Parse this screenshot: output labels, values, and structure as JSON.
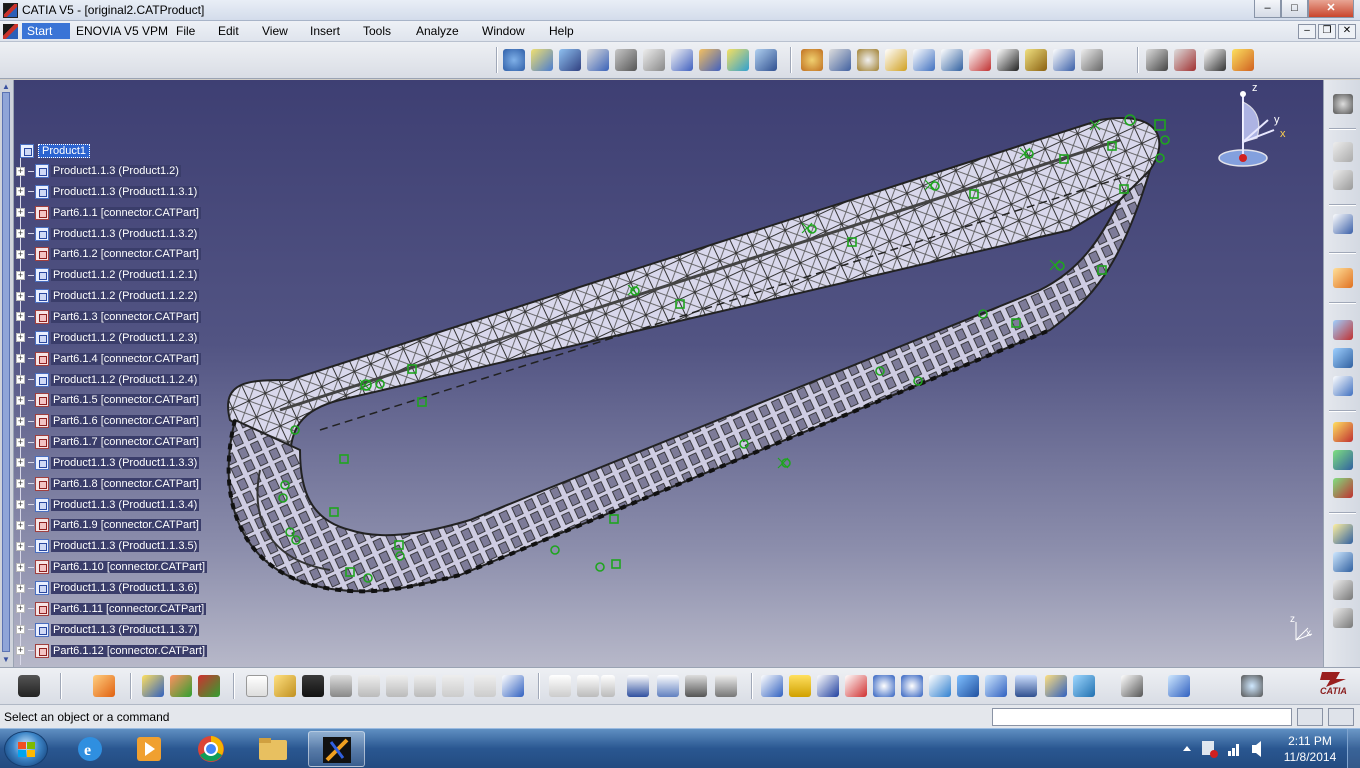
{
  "window": {
    "title": "CATIA V5 - [original2.CATProduct]",
    "buttons": {
      "minimize": "–",
      "maximize": "□",
      "close": "✕"
    }
  },
  "menu": {
    "items": [
      "Start",
      "ENOVIA V5 VPM",
      "File",
      "Edit",
      "View",
      "Insert",
      "Tools",
      "Analyze",
      "Window",
      "Help"
    ],
    "doc_buttons": {
      "minimize": "–",
      "restore": "❐",
      "close": "✕"
    }
  },
  "tree": {
    "root": "Product1",
    "nodes": [
      {
        "label": "Product1.1.3 (Product1.2)",
        "kind": "product"
      },
      {
        "label": "Product1.1.3 (Product1.1.3.1)",
        "kind": "product"
      },
      {
        "label": "Part6.1.1 [connector.CATPart]",
        "kind": "part"
      },
      {
        "label": "Product1.1.3 (Product1.1.3.2)",
        "kind": "product"
      },
      {
        "label": "Part6.1.2 [connector.CATPart]",
        "kind": "part"
      },
      {
        "label": "Product1.1.2 (Product1.1.2.1)",
        "kind": "product"
      },
      {
        "label": "Product1.1.2 (Product1.1.2.2)",
        "kind": "product"
      },
      {
        "label": "Part6.1.3 [connector.CATPart]",
        "kind": "part"
      },
      {
        "label": "Product1.1.2 (Product1.1.2.3)",
        "kind": "product"
      },
      {
        "label": "Part6.1.4 [connector.CATPart]",
        "kind": "part"
      },
      {
        "label": "Product1.1.2 (Product1.1.2.4)",
        "kind": "product"
      },
      {
        "label": "Part6.1.5 [connector.CATPart]",
        "kind": "part"
      },
      {
        "label": "Part6.1.6 [connector.CATPart]",
        "kind": "part"
      },
      {
        "label": "Part6.1.7 [connector.CATPart]",
        "kind": "part"
      },
      {
        "label": "Product1.1.3 (Product1.1.3.3)",
        "kind": "product"
      },
      {
        "label": "Part6.1.8 [connector.CATPart]",
        "kind": "part"
      },
      {
        "label": "Product1.1.3 (Product1.1.3.4)",
        "kind": "product"
      },
      {
        "label": "Part6.1.9 [connector.CATPart]",
        "kind": "part"
      },
      {
        "label": "Product1.1.3 (Product1.1.3.5)",
        "kind": "product"
      },
      {
        "label": "Part6.1.10 [connector.CATPart]",
        "kind": "part"
      },
      {
        "label": "Product1.1.3 (Product1.1.3.6)",
        "kind": "product"
      },
      {
        "label": "Part6.1.11 [connector.CATPart]",
        "kind": "part"
      },
      {
        "label": "Product1.1.3 (Product1.1.3.7)",
        "kind": "product"
      },
      {
        "label": "Part6.1.12 [connector.CATPart]",
        "kind": "part"
      }
    ]
  },
  "compass": {
    "z": "z",
    "y": "y",
    "x": "x"
  },
  "mini_axes": {
    "z": "z",
    "x": "x"
  },
  "logo": {
    "text": "CATIA"
  },
  "status": {
    "message": "Select an object or a command",
    "command_value": "",
    "command_placeholder": ""
  },
  "taskbar": {
    "time": "2:11 PM",
    "date": "11/8/2014"
  },
  "colors": {
    "selection": "#2b63d0",
    "viewport_top": "#3e3f73",
    "viewport_bottom": "#b7b8c9",
    "constraint_green": "#1fa51f"
  }
}
